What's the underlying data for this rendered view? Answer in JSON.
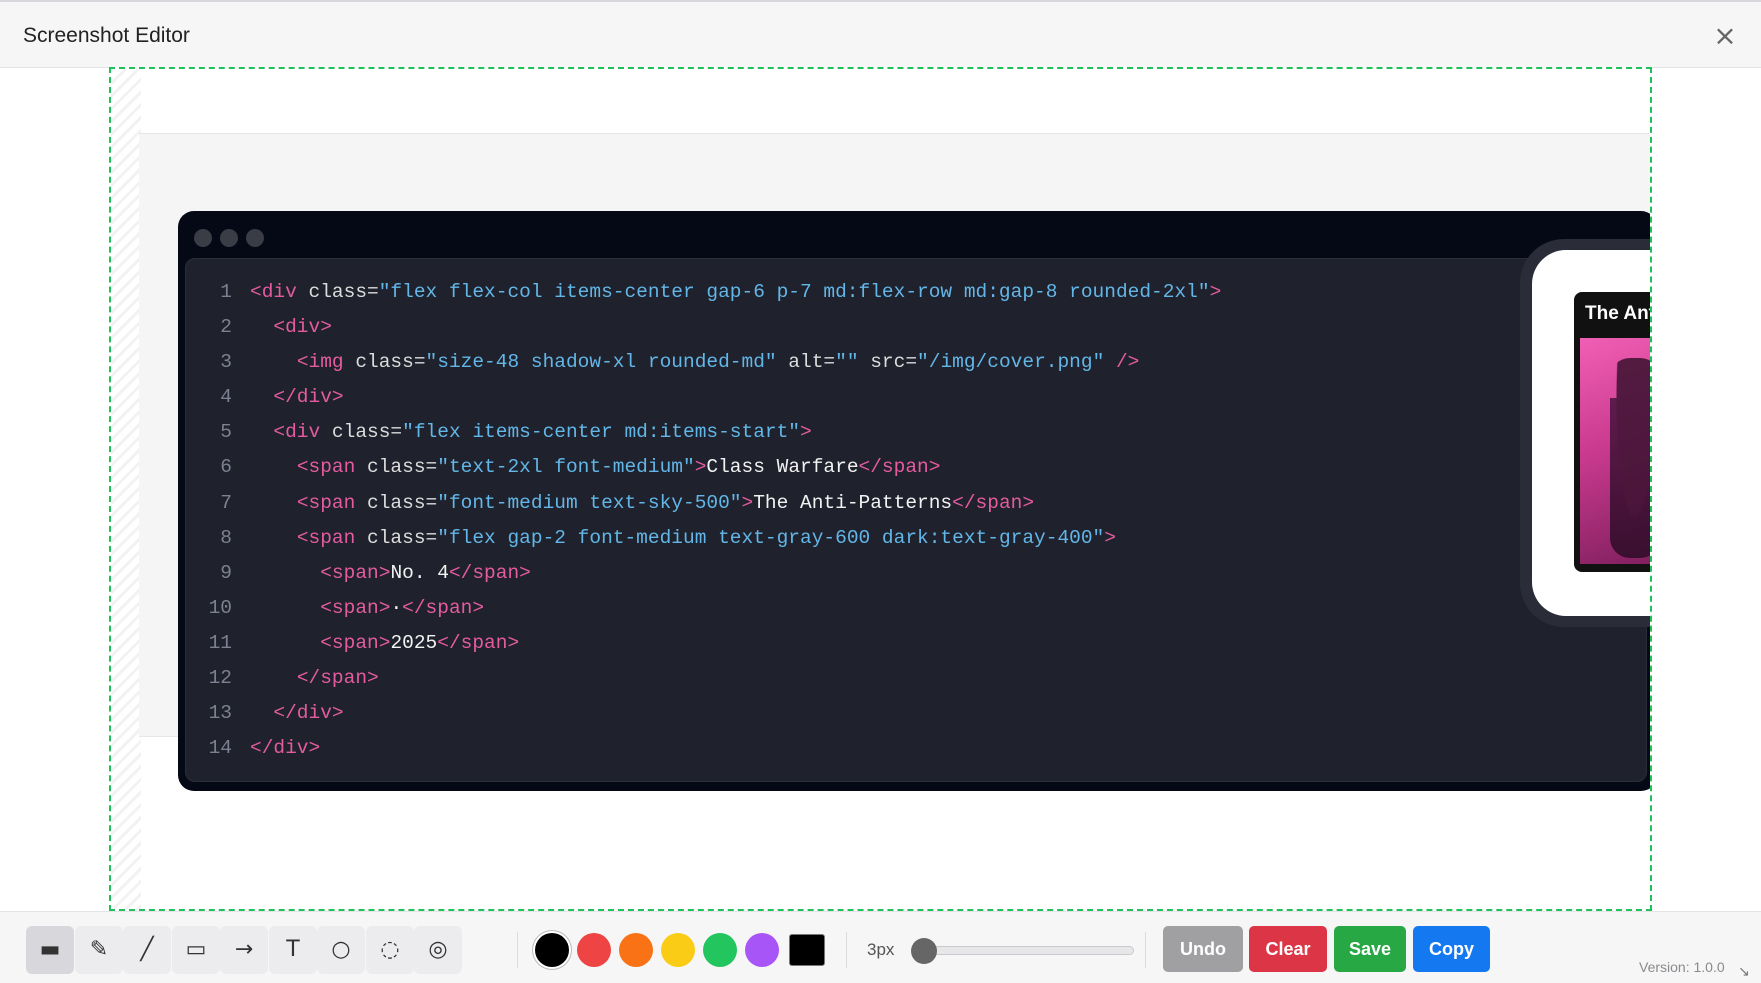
{
  "window": {
    "title": "Screenshot Editor",
    "close_glyph": "×"
  },
  "code": {
    "lines": [
      {
        "n": "1",
        "parts": [
          [
            "tag",
            "<div "
          ],
          [
            "attr",
            "class="
          ],
          [
            "str",
            "\"flex flex-col items-center gap-6 p-7 md:flex-row md:gap-8 rounded-2xl\""
          ],
          [
            "tag",
            ">"
          ]
        ]
      },
      {
        "n": "2",
        "parts": [
          [
            "txt",
            "  "
          ],
          [
            "tag",
            "<div>"
          ]
        ]
      },
      {
        "n": "3",
        "parts": [
          [
            "txt",
            "    "
          ],
          [
            "tag",
            "<img "
          ],
          [
            "attr",
            "class="
          ],
          [
            "str",
            "\"size-48 shadow-xl rounded-md\""
          ],
          [
            "attr",
            " alt="
          ],
          [
            "str",
            "\"\""
          ],
          [
            "attr",
            " src="
          ],
          [
            "str",
            "\"/img/cover.png\""
          ],
          [
            "tag",
            " />"
          ]
        ]
      },
      {
        "n": "4",
        "parts": [
          [
            "txt",
            "  "
          ],
          [
            "tag",
            "</div>"
          ]
        ]
      },
      {
        "n": "5",
        "parts": [
          [
            "txt",
            "  "
          ],
          [
            "tag",
            "<div "
          ],
          [
            "attr",
            "class="
          ],
          [
            "str",
            "\"flex items-center md:items-start\""
          ],
          [
            "tag",
            ">"
          ]
        ]
      },
      {
        "n": "6",
        "parts": [
          [
            "txt",
            "    "
          ],
          [
            "tag",
            "<span "
          ],
          [
            "attr",
            "class="
          ],
          [
            "str",
            "\"text-2xl font-medium\""
          ],
          [
            "tag",
            ">"
          ],
          [
            "txt",
            "Class Warfare"
          ],
          [
            "tag",
            "</span>"
          ]
        ]
      },
      {
        "n": "7",
        "parts": [
          [
            "txt",
            "    "
          ],
          [
            "tag",
            "<span "
          ],
          [
            "attr",
            "class="
          ],
          [
            "str",
            "\"font-medium text-sky-500\""
          ],
          [
            "tag",
            ">"
          ],
          [
            "txt",
            "The Anti-Patterns"
          ],
          [
            "tag",
            "</span>"
          ]
        ]
      },
      {
        "n": "8",
        "parts": [
          [
            "txt",
            "    "
          ],
          [
            "tag",
            "<span "
          ],
          [
            "attr",
            "class="
          ],
          [
            "str",
            "\"flex gap-2 font-medium text-gray-600 dark:text-gray-400\""
          ],
          [
            "tag",
            ">"
          ]
        ]
      },
      {
        "n": "9",
        "parts": [
          [
            "txt",
            "      "
          ],
          [
            "tag",
            "<span>"
          ],
          [
            "txt",
            "No. 4"
          ],
          [
            "tag",
            "</span>"
          ]
        ]
      },
      {
        "n": "10",
        "parts": [
          [
            "txt",
            "      "
          ],
          [
            "tag",
            "<span>"
          ],
          [
            "txt",
            "·"
          ],
          [
            "tag",
            "</span>"
          ]
        ]
      },
      {
        "n": "11",
        "parts": [
          [
            "txt",
            "      "
          ],
          [
            "tag",
            "<span>"
          ],
          [
            "txt",
            "2025"
          ],
          [
            "tag",
            "</span>"
          ]
        ]
      },
      {
        "n": "12",
        "parts": [
          [
            "txt",
            "    "
          ],
          [
            "tag",
            "</span>"
          ]
        ]
      },
      {
        "n": "13",
        "parts": [
          [
            "txt",
            "  "
          ],
          [
            "tag",
            "</div>"
          ]
        ]
      },
      {
        "n": "14",
        "parts": [
          [
            "tag",
            "</div>"
          ]
        ]
      }
    ]
  },
  "preview": {
    "cover_title": "The Anti"
  },
  "toolbar": {
    "tools": [
      {
        "name": "highlighter-tool",
        "glyph": "▬"
      },
      {
        "name": "pen-tool",
        "glyph": "✎"
      },
      {
        "name": "line-tool",
        "glyph": "╱"
      },
      {
        "name": "rectangle-tool",
        "glyph": "▭"
      },
      {
        "name": "arrow-tool",
        "glyph": "→"
      },
      {
        "name": "text-tool",
        "glyph": "T"
      },
      {
        "name": "circle-tool",
        "glyph": "○"
      },
      {
        "name": "blur-tool",
        "glyph": "◌"
      },
      {
        "name": "spotlight-tool",
        "glyph": "◎"
      }
    ],
    "active_tool": 0,
    "colors": [
      "#000000",
      "#ef4444",
      "#f97316",
      "#facc15",
      "#22c55e",
      "#a855f7"
    ],
    "selected_color": 0,
    "custom_color": "#000000",
    "size_label": "3px",
    "size_level": 0.0,
    "buttons": [
      {
        "name": "undo-button",
        "label": "Undo",
        "color": "#a0a0a3"
      },
      {
        "name": "clear-button",
        "label": "Clear",
        "color": "#dc3545"
      },
      {
        "name": "save-button",
        "label": "Save",
        "color": "#28a745"
      },
      {
        "name": "copy-button",
        "label": "Copy",
        "color": "#1478f0"
      }
    ],
    "version": "Version: 1.0.0"
  }
}
